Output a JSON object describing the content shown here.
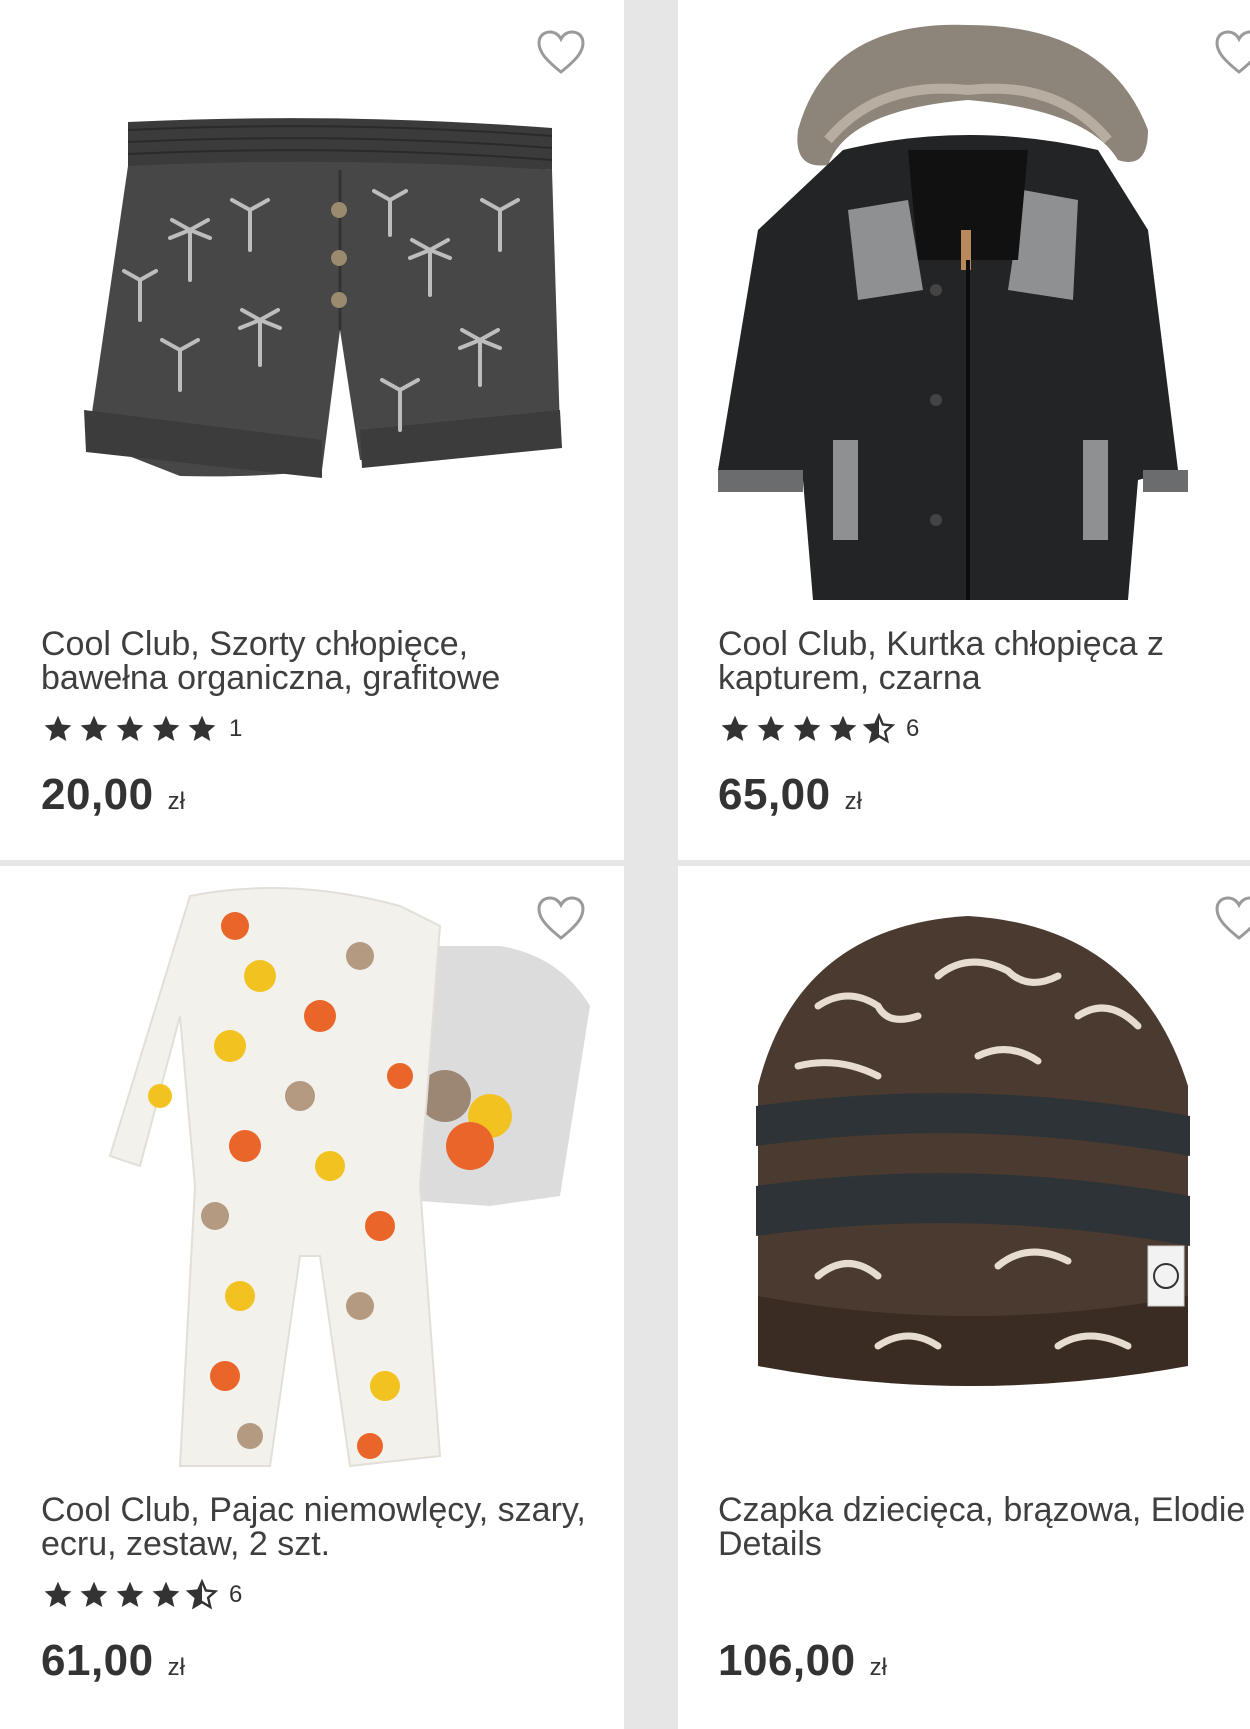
{
  "colors": {
    "background": "#e6e6e6",
    "card": "#ffffff",
    "text": "#3f3f3f",
    "star": "#333333",
    "heart_outline": "#9a9a9a"
  },
  "products": [
    {
      "title": "Cool Club, Szorty chłopięce, bawełna organiczna, grafitowe",
      "rating_stars": 5,
      "rating_count": "1",
      "price": "20,00",
      "currency": "zł",
      "image": "graphite-shorts-palm-print"
    },
    {
      "title": "Cool Club, Kurtka chłopięca z kapturem, czarna",
      "rating_stars": 4.5,
      "rating_count": "6",
      "price": "65,00",
      "currency": "zł",
      "image": "black-hooded-jacket-fur-trim"
    },
    {
      "title": "Cool Club, Pajac niemowlęcy, szary, ecru, zestaw, 2 szt.",
      "rating_stars": 4.5,
      "rating_count": "6",
      "price": "61,00",
      "currency": "zł",
      "image": "pumpkin-print-romper-set"
    },
    {
      "title": "Czapka dziecięca, brązowa, Elodie Details",
      "rating_stars": null,
      "rating_count": null,
      "price": "106,00",
      "currency": "zł",
      "image": "brown-beanie-panther-print"
    }
  ]
}
